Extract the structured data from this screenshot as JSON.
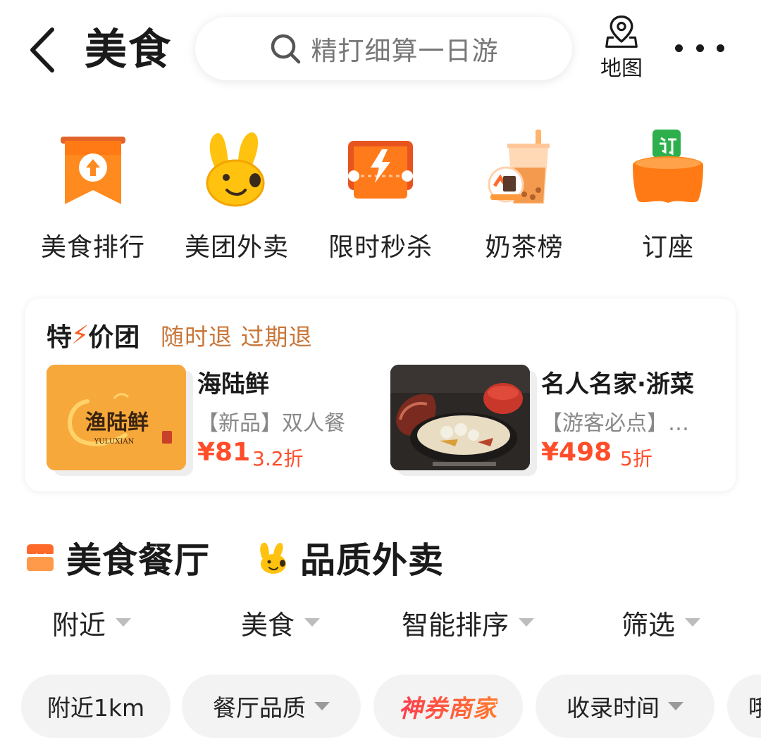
{
  "header": {
    "title": "美食",
    "search_placeholder": "精打细算一日游",
    "map_label": "地图",
    "icons": {
      "back": "chevron-left-icon",
      "search": "search-icon",
      "map": "map-pin-icon",
      "more": "more-dots-icon"
    }
  },
  "categories": [
    {
      "label": "美食排行",
      "icon": "ranking-banner-icon"
    },
    {
      "label": "美团外卖",
      "icon": "kangaroo-icon"
    },
    {
      "label": "限时秒杀",
      "icon": "flash-ticket-icon"
    },
    {
      "label": "奶茶榜",
      "icon": "milk-tea-icon"
    },
    {
      "label": "订座",
      "icon": "table-reserve-icon"
    }
  ],
  "deals": {
    "title_pre": "特",
    "title_post": "价团",
    "subtitle": "随时退 过期退",
    "items": [
      {
        "name": "海陆鲜",
        "desc": "【新品】双人餐",
        "price": "¥81",
        "discount": "3.2折",
        "logo_text": "渔陆鲜",
        "logo_sub": "YULUXIAN"
      },
      {
        "name": "名人名家·浙菜",
        "desc": "【游客必点】江…",
        "price": "¥498",
        "discount": "5折"
      }
    ]
  },
  "section_tabs": [
    {
      "label": "美食餐厅",
      "active": true,
      "icon": "restaurant-icon"
    },
    {
      "label": "品质外卖",
      "active": false,
      "icon": "kangaroo-icon"
    }
  ],
  "filters": [
    {
      "label": "附近"
    },
    {
      "label": "美食"
    },
    {
      "label": "智能排序"
    },
    {
      "label": "筛选"
    }
  ],
  "chips": [
    {
      "label": "附近1km",
      "dropdown": false
    },
    {
      "label": "餐厅品质",
      "dropdown": true
    },
    {
      "label": "神券商家",
      "dropdown": false,
      "brand": true
    },
    {
      "label": "收录时间",
      "dropdown": true
    },
    {
      "label": "哦",
      "dropdown": false
    }
  ],
  "colors": {
    "accent_orange": "#ff8a1f",
    "price_red": "#ff4d2a",
    "subtitle_brown": "#c9773a",
    "chip_bg": "#f3f3f3"
  }
}
